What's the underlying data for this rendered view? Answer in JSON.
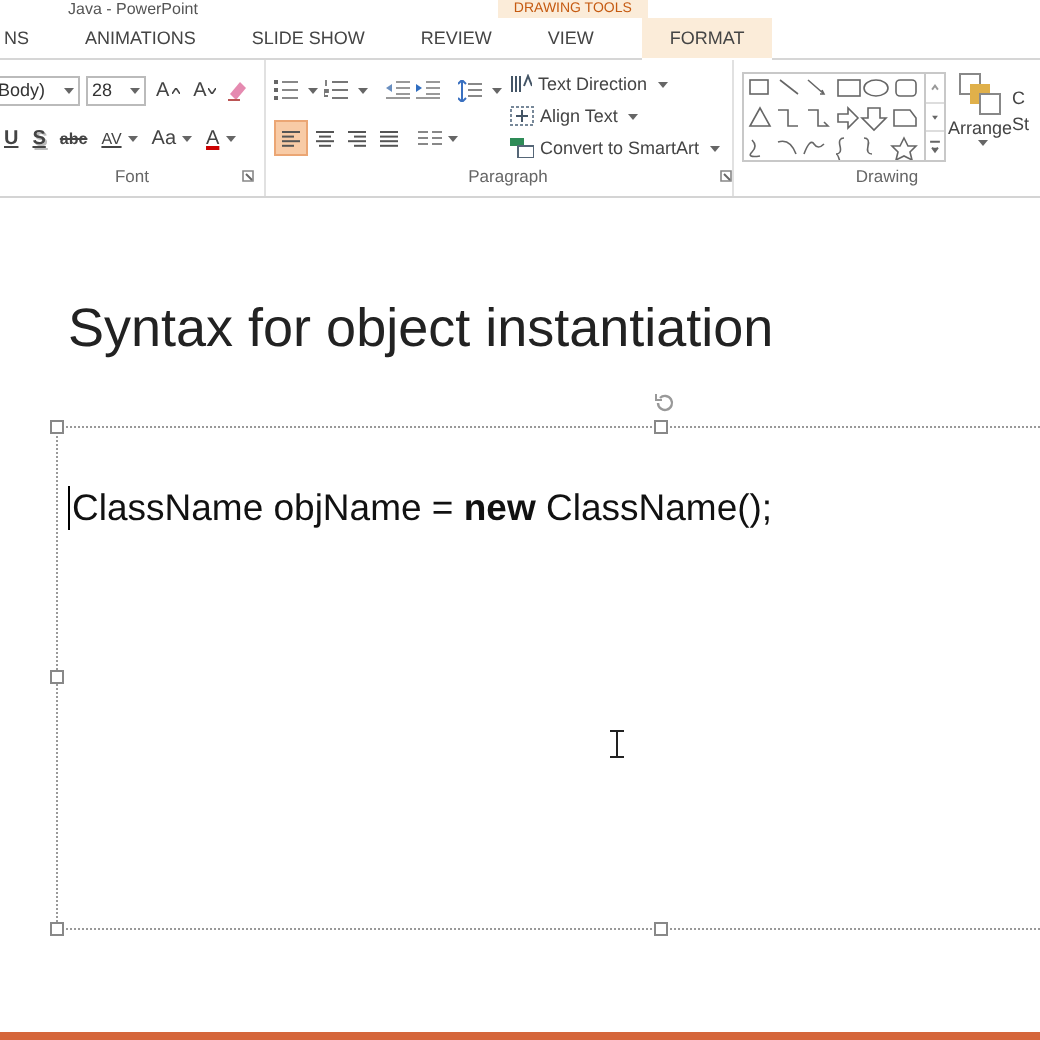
{
  "window": {
    "title": "Java - PowerPoint"
  },
  "ribbon_tabs": {
    "context_label": "DRAWING TOOLS",
    "tabs": [
      {
        "label": "NS",
        "selected": false
      },
      {
        "label": "ANIMATIONS",
        "selected": false
      },
      {
        "label": "SLIDE SHOW",
        "selected": false
      },
      {
        "label": "REVIEW",
        "selected": false
      },
      {
        "label": "VIEW",
        "selected": false
      },
      {
        "label": "FORMAT",
        "selected": true
      }
    ]
  },
  "font_group": {
    "font_name": "Body)",
    "font_size": "28",
    "label": "Font",
    "size_buttons": [
      {
        "kind": "grow",
        "label": "A"
      },
      {
        "kind": "shrink",
        "label": "A"
      }
    ],
    "format_buttons": [
      {
        "kind": "underline",
        "label": "U"
      },
      {
        "kind": "shadow",
        "label": "S"
      },
      {
        "kind": "strike",
        "label": "abc"
      },
      {
        "kind": "spacing",
        "label": "AV"
      },
      {
        "kind": "case",
        "label": "Aa"
      },
      {
        "kind": "color",
        "label": "A"
      }
    ]
  },
  "paragraph_group": {
    "label": "Paragraph",
    "alignments": [
      {
        "kind": "left",
        "selected": true
      },
      {
        "kind": "center",
        "selected": false
      },
      {
        "kind": "right",
        "selected": false
      },
      {
        "kind": "justify",
        "selected": false
      }
    ],
    "commands": [
      {
        "kind": "direction",
        "label": "Text Direction"
      },
      {
        "kind": "align",
        "label": "Align Text"
      },
      {
        "kind": "smartart",
        "label": "Convert to SmartArt"
      }
    ]
  },
  "drawing_group": {
    "label": "Drawing",
    "arrange": "Arrange",
    "quick_styles": [
      "C",
      "St"
    ]
  },
  "slide": {
    "title": "Syntax for object instantiation",
    "body": "ClassName objName = **new** ClassName();"
  }
}
